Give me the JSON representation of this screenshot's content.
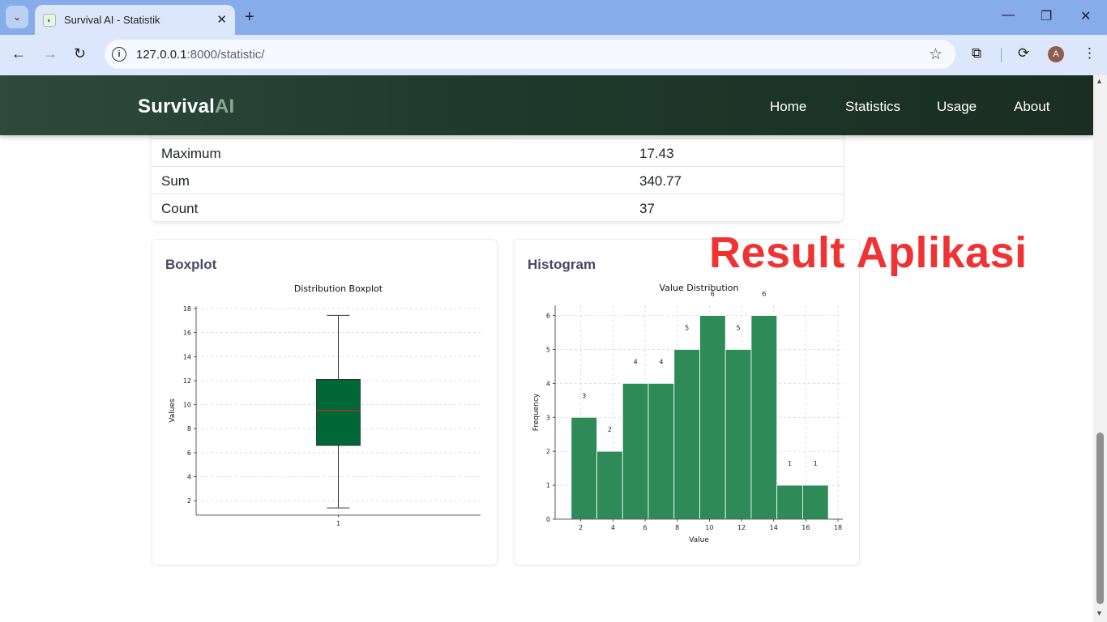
{
  "browser": {
    "tab_title": "Survival AI - Statistik",
    "url_host": "127.0.0.1",
    "url_rest": ":8000/statistic/"
  },
  "navbar": {
    "brand_main": "Survival",
    "brand_accent": "AI",
    "links": [
      "Home",
      "Statistics",
      "Usage",
      "About"
    ]
  },
  "stats": {
    "rows": [
      {
        "label": "Maximum",
        "value": "17.43"
      },
      {
        "label": "Sum",
        "value": "340.77"
      },
      {
        "label": "Count",
        "value": "37"
      }
    ]
  },
  "cards": {
    "boxplot_title": "Boxplot",
    "histogram_title": "Histogram"
  },
  "overlay_text": "Result Aplikasi",
  "colors": {
    "navbar": "#1e3a2c",
    "box_fill": "#006837",
    "median": "#d62728",
    "hist_fill": "#2e8b57",
    "overlay": "#f03232"
  },
  "chart_data": [
    {
      "type": "boxplot",
      "title": "Distribution Boxplot",
      "ylabel": "Values",
      "xlabel": "",
      "categories": [
        "1"
      ],
      "box": {
        "min": 1.4,
        "q1": 6.6,
        "median": 9.5,
        "q3": 12.1,
        "max": 17.43
      },
      "ylim": [
        0.8,
        18.2
      ],
      "yticks": [
        2,
        4,
        6,
        8,
        10,
        12,
        14,
        16,
        18
      ],
      "grid": true
    },
    {
      "type": "bar",
      "subtype": "histogram",
      "title": "Value Distribution",
      "xlabel": "Value",
      "ylabel": "Frequency",
      "bin_edges": [
        1.4,
        3.0,
        4.6,
        6.2,
        7.8,
        9.4,
        11.0,
        12.6,
        14.2,
        15.8,
        17.4
      ],
      "values": [
        3,
        2,
        4,
        4,
        5,
        6,
        5,
        6,
        1,
        1
      ],
      "xlim": [
        0.4,
        18.3
      ],
      "ylim": [
        0,
        6.3
      ],
      "xticks": [
        2,
        4,
        6,
        8,
        10,
        12,
        14,
        16,
        18
      ],
      "yticks": [
        0,
        1,
        2,
        3,
        4,
        5,
        6
      ],
      "grid": true
    }
  ]
}
